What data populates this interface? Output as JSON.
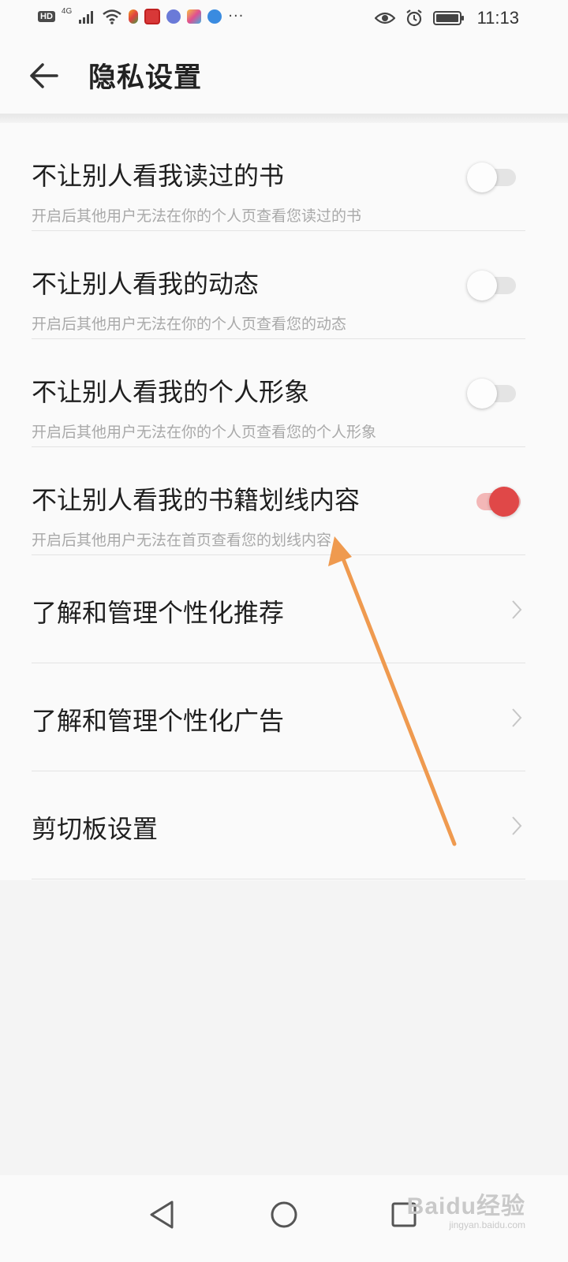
{
  "status_bar": {
    "hd_badge": "HD",
    "network": "4G",
    "time": "11:13",
    "icons": [
      "signal-icon",
      "wifi-icon",
      "eye-icon",
      "alarm-icon",
      "battery-icon"
    ]
  },
  "header": {
    "title": "隐私设置",
    "back_icon": "arrow-left-icon"
  },
  "settings": {
    "toggles": [
      {
        "title": "不让别人看我读过的书",
        "description": "开启后其他用户无法在你的个人页查看您读过的书",
        "enabled": false
      },
      {
        "title": "不让别人看我的动态",
        "description": "开启后其他用户无法在你的个人页查看您的动态",
        "enabled": false
      },
      {
        "title": "不让别人看我的个人形象",
        "description": "开启后其他用户无法在你的个人页查看您的个人形象",
        "enabled": false
      },
      {
        "title": "不让别人看我的书籍划线内容",
        "description": "开启后其他用户无法在首页查看您的划线内容",
        "enabled": true
      }
    ],
    "links": [
      {
        "title": "了解和管理个性化推荐"
      },
      {
        "title": "了解和管理个性化广告"
      },
      {
        "title": "剪切板设置"
      }
    ]
  },
  "colors": {
    "toggle_on": "#e04848",
    "toggle_on_track": "#f3b7b7",
    "toggle_off_track": "#e4e4e4",
    "annotation_arrow": "#ef9a4f"
  },
  "nav_bar": {
    "icons": [
      "back-triangle-icon",
      "home-circle-icon",
      "recents-square-icon"
    ]
  },
  "watermark": {
    "brand": "Baidu经验",
    "url": "jingyan.baidu.com"
  }
}
